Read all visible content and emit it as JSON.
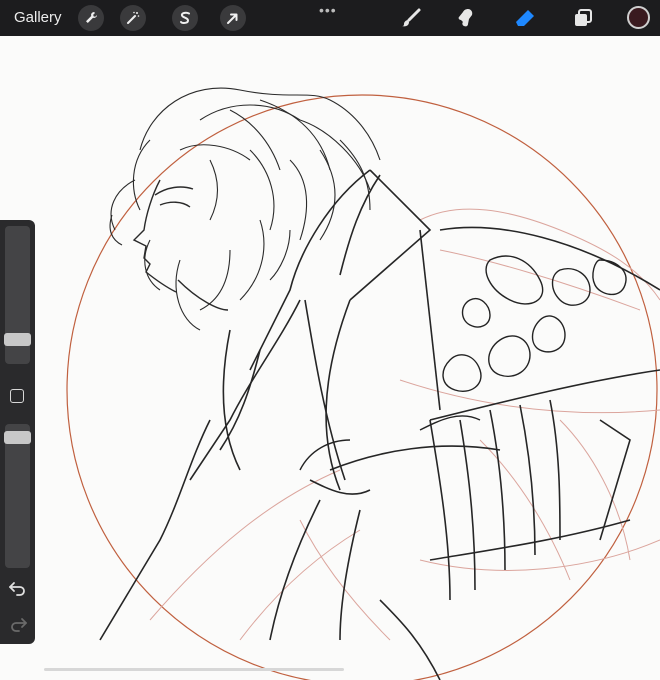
{
  "toolbar": {
    "gallery_label": "Gallery",
    "left_tools": [
      {
        "name": "actions",
        "icon": "wrench-icon"
      },
      {
        "name": "adjustments",
        "icon": "magic-wand-icon"
      },
      {
        "name": "selection",
        "icon": "selection-s-icon"
      },
      {
        "name": "transform",
        "icon": "arrow-cursor-icon"
      }
    ],
    "more_label": "•••",
    "right_tools": [
      {
        "name": "brush",
        "icon": "brush-icon",
        "active": false
      },
      {
        "name": "smudge",
        "icon": "smudge-icon",
        "active": false
      },
      {
        "name": "eraser",
        "icon": "eraser-icon",
        "active": true
      },
      {
        "name": "layers",
        "icon": "layers-icon",
        "active": false
      }
    ],
    "current_color": "#3a1a1f"
  },
  "sidebar": {
    "brush_size_level": 0.17,
    "brush_opacity_level": 0.83,
    "modify_icon": "square-icon",
    "undo_icon": "undo-icon",
    "redo_icon": "redo-icon"
  },
  "colors": {
    "accent_active": "#1e88ff",
    "guide_circle": "#c05a3c",
    "ink": "#2a2a2a",
    "sketch_red": "#d9a29a"
  }
}
